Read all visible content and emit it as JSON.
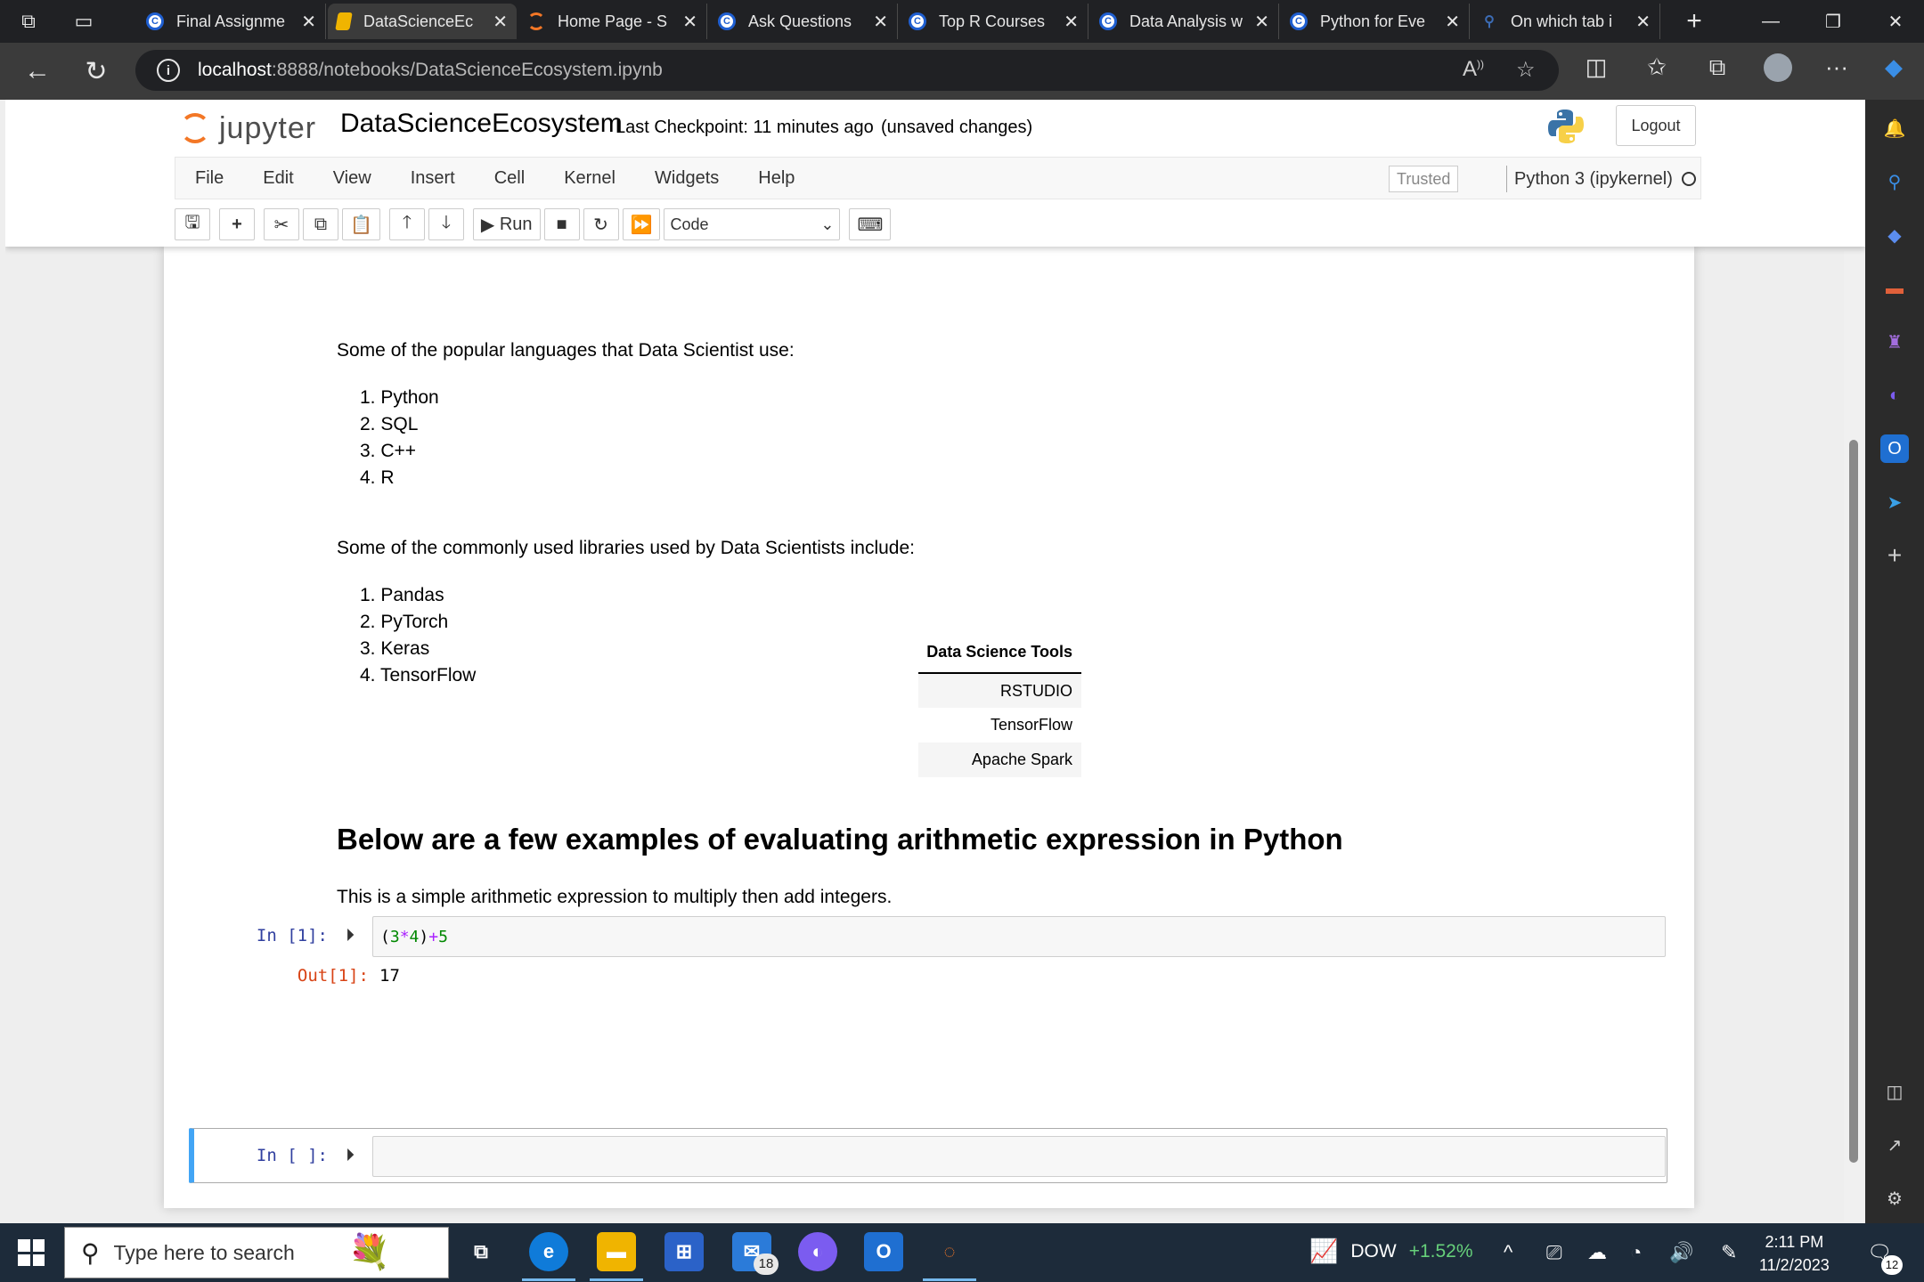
{
  "browser": {
    "tabs": [
      {
        "label": "Final Assignme",
        "icon": "coursera-icon",
        "active": false
      },
      {
        "label": "DataScienceEc",
        "icon": "jupyter-notebook-icon",
        "active": true
      },
      {
        "label": "Home Page - S",
        "icon": "jupyter-icon",
        "active": false
      },
      {
        "label": "Ask Questions",
        "icon": "coursera-icon",
        "active": false
      },
      {
        "label": "Top R Courses",
        "icon": "coursera-icon",
        "active": false
      },
      {
        "label": "Data Analysis w",
        "icon": "coursera-icon",
        "active": false
      },
      {
        "label": "Python for Eve",
        "icon": "coursera-icon",
        "active": false
      },
      {
        "label": "On which tab i",
        "icon": "search-icon",
        "active": false
      }
    ],
    "url_host": "localhost",
    "url_rest": ":8888/notebooks/DataScienceEcosystem.ipynb"
  },
  "jupyter": {
    "logo_text": "jupyter",
    "notebook_title": "DataScienceEcosystem",
    "checkpoint": "Last Checkpoint: 11 minutes ago",
    "save_status": "(unsaved changes)",
    "logout_label": "Logout",
    "menu": [
      "File",
      "Edit",
      "View",
      "Insert",
      "Cell",
      "Kernel",
      "Widgets",
      "Help"
    ],
    "trusted_label": "Trusted",
    "kernel_label": "Python 3 (ipykernel)",
    "run_label": "Run",
    "cell_type": "Code"
  },
  "notebook": {
    "languages_intro": "Some of the popular languages that Data Scientist use:",
    "languages": [
      "1. Python",
      "2. SQL",
      "3. C++",
      "4. R"
    ],
    "libraries_intro": "Some of the commonly used libraries used by Data Scientists include:",
    "libraries": [
      "1. Pandas",
      "2. PyTorch",
      "3. Keras",
      "4. TensorFlow"
    ],
    "tools_table": {
      "header": "Data Science Tools",
      "rows": [
        "RSTUDIO",
        "TensorFlow",
        "Apache Spark"
      ]
    },
    "heading": "Below are a few examples of evaluating arithmetic expression in Python",
    "arith_text": "This is a simple arithmetic expression to multiply then add integers.",
    "cell1_prompt": "In [1]:",
    "cell1_code_open": "(",
    "cell1_code_a": "3",
    "cell1_code_op1": "*",
    "cell1_code_b": "4",
    "cell1_code_close": ")",
    "cell1_code_op2": "+",
    "cell1_code_c": "5",
    "out1_prompt": "Out[1]:",
    "out1_value": "17",
    "cell2_prompt": "In [ ]:"
  },
  "taskbar": {
    "search_placeholder": "Type here to search",
    "mail_badge": "18",
    "stock_name": "DOW",
    "stock_change": "+1.52%",
    "time": "2:11 PM",
    "date": "11/2/2023",
    "notification_count": "12"
  },
  "colors": {
    "jupyter_orange": "#f37726",
    "in_prompt": "#303f9f",
    "out_prompt": "#d84315",
    "selected_cell": "#42a5f5",
    "number_green": "#008800",
    "operator_purple": "#aa22ff"
  }
}
